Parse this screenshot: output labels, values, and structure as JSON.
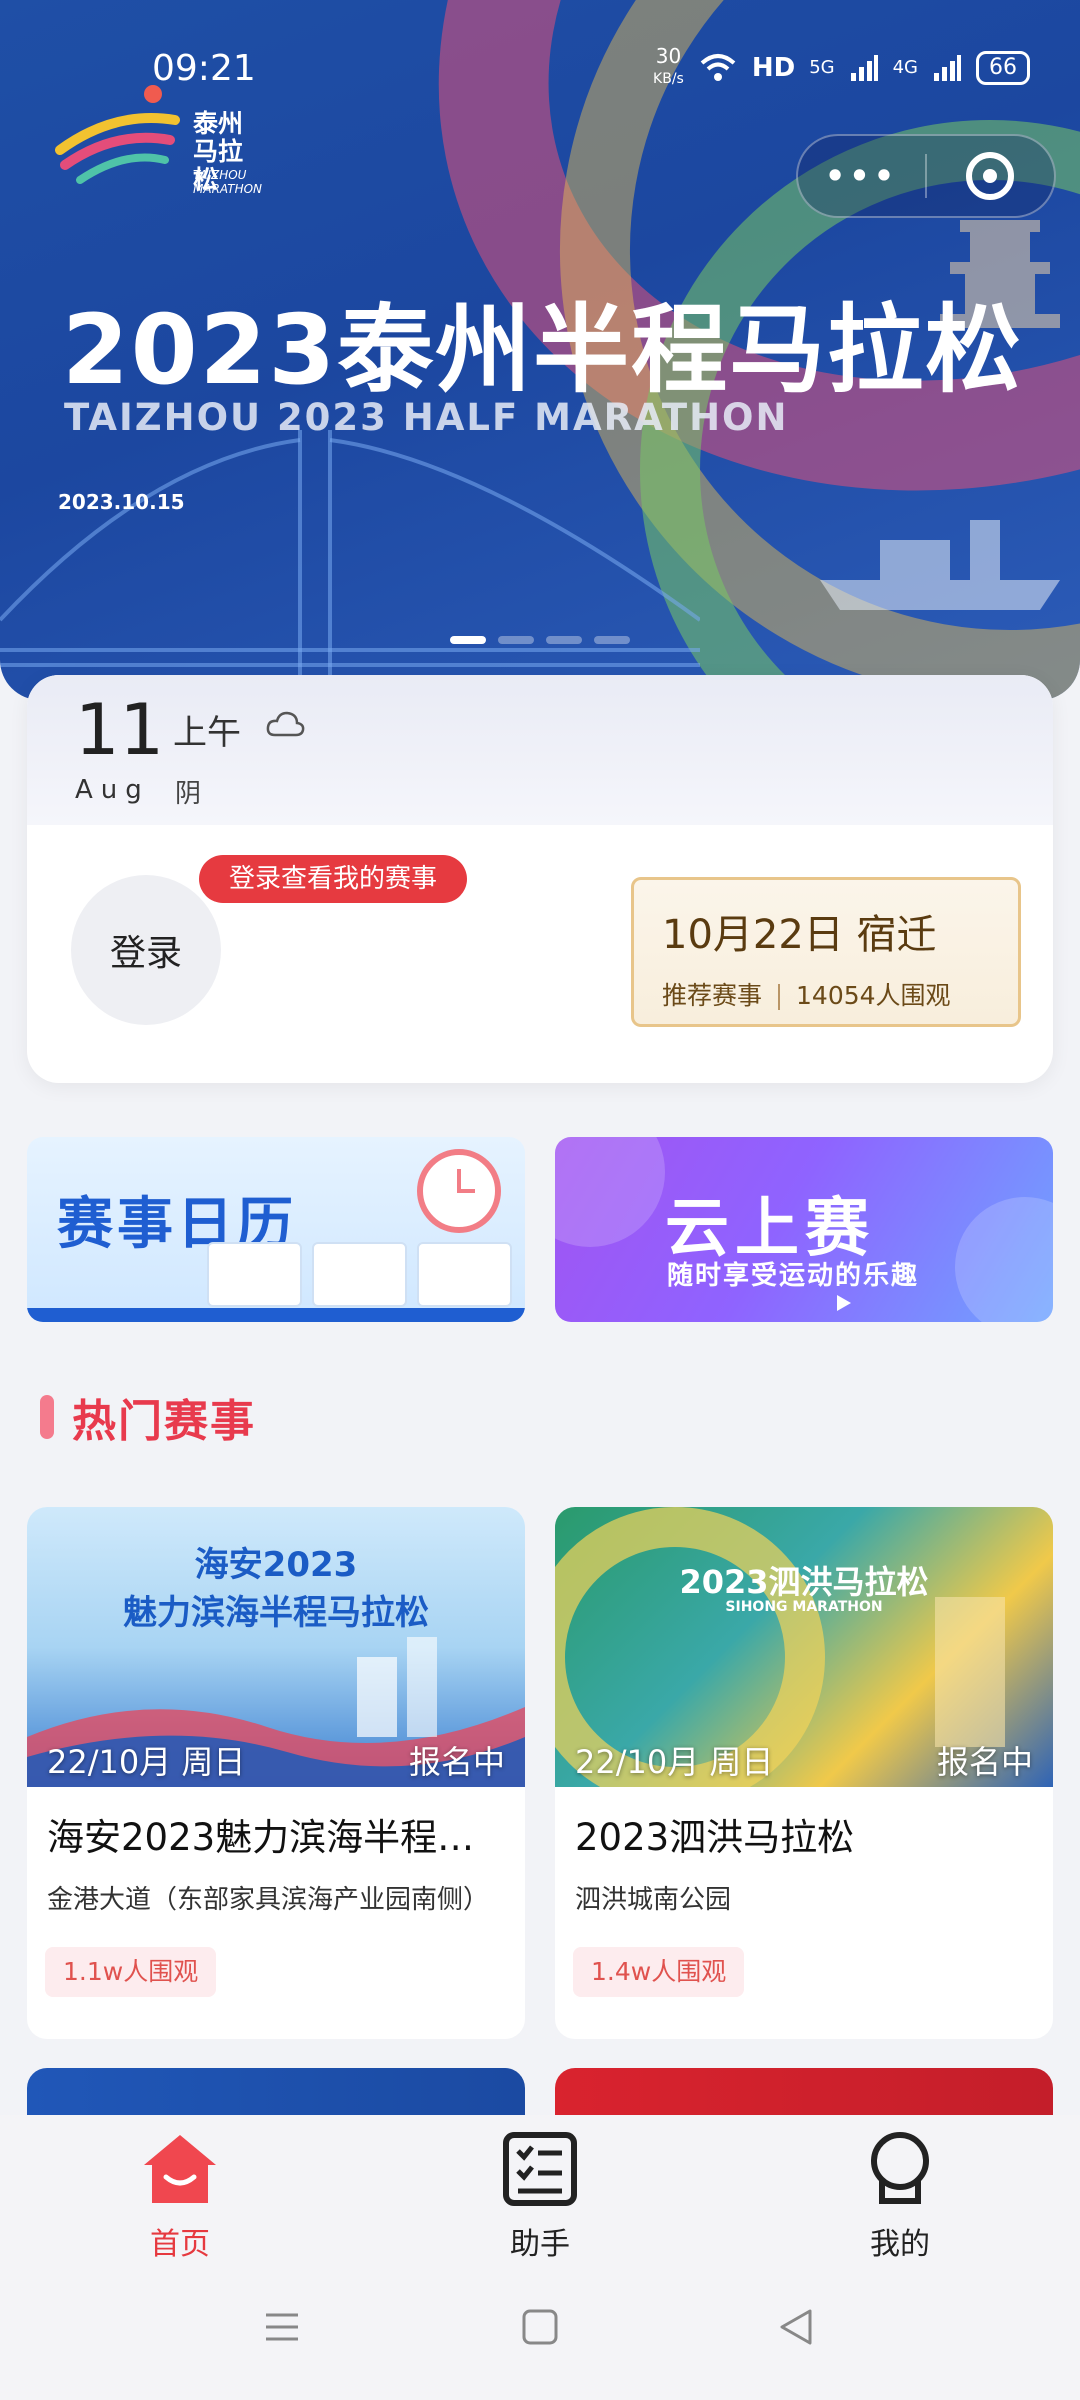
{
  "status_bar": {
    "time": "09:21",
    "speed": "30",
    "speed_unit": "KB/s",
    "hd": "HD",
    "net1": "5G",
    "net2": "4G",
    "battery": "66"
  },
  "banner": {
    "logo_cn": "泰州马拉松",
    "logo_en": "TAIZHOU MARATHON",
    "title": "2023泰州半程马拉松",
    "subtitle": "TAIZHOU 2023 HALF MARATHON",
    "date": "2023.10.15",
    "active_slide": 1,
    "slide_count": 4
  },
  "capsule": {
    "more": "•••"
  },
  "today": {
    "day": "11",
    "period": "上午",
    "month": "Aug",
    "weather": "阴",
    "weather_icon": "cloud-icon"
  },
  "login": {
    "avatar_label": "登录",
    "bubble": "登录查看我的赛事"
  },
  "recommend": {
    "date_city": "10月22日 宿迁",
    "tag": "推荐赛事",
    "views": "14054人围观"
  },
  "features": {
    "calendar_title": "赛事日历",
    "cloud_title": "云上赛",
    "cloud_subtitle": "随时享受运动的乐趣"
  },
  "section": {
    "title": "热门赛事"
  },
  "events": [
    {
      "poster_line1": "海安2023",
      "poster_line2": "魅力滨海半程马拉松",
      "date": "22/10月 周日",
      "status": "报名中",
      "name": "海安2023魅力滨海半程…",
      "location": "金港大道（东部家具滨海产业园南侧）",
      "views": "1.1w人围观"
    },
    {
      "poster_line1": "2023泗洪马拉松",
      "poster_line2": "SIHONG MARATHON",
      "date": "22/10月 周日",
      "status": "报名中",
      "name": "2023泗洪马拉松",
      "location": "泗洪城南公园",
      "views": "1.4w人围观"
    }
  ],
  "tabbar": {
    "active": "home",
    "items": [
      {
        "key": "home",
        "label": "首页",
        "icon": "home-icon"
      },
      {
        "key": "assistant",
        "label": "助手",
        "icon": "checklist-icon"
      },
      {
        "key": "mine",
        "label": "我的",
        "icon": "profile-icon"
      }
    ]
  },
  "colors": {
    "accent": "#e6393f",
    "banner_blue": "#1f4fa6",
    "recommend_border": "#e8c58a"
  }
}
